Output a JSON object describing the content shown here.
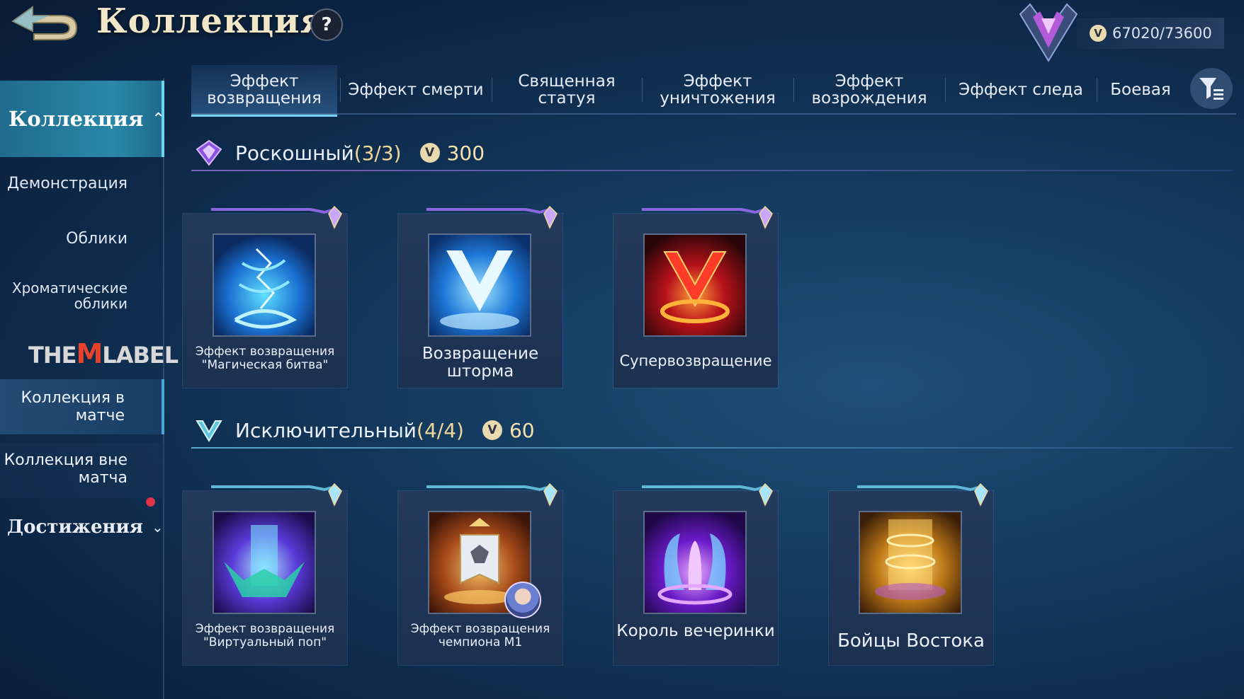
{
  "header": {
    "title": "Коллекция",
    "help_label": "?",
    "points": "67020/73600",
    "coin_glyph": "V"
  },
  "sidebar": {
    "active": "Коллекция",
    "items": [
      {
        "label": "Демонстрация"
      },
      {
        "label": "Облики"
      },
      {
        "label": "Хроматические облики"
      },
      {
        "label": "Коллекция в матче"
      },
      {
        "label": "Коллекция вне матча"
      }
    ],
    "brand_logo": {
      "pre": "THE",
      "m": "M",
      "post": "LABEL"
    },
    "achievements": "Достижения"
  },
  "tabs": [
    {
      "label": "Эффект возвращения",
      "active": true
    },
    {
      "label": "Эффект смерти"
    },
    {
      "label": "Священная статуя"
    },
    {
      "label": "Эффект уничтожения"
    },
    {
      "label": "Эффект возрождения"
    },
    {
      "label": "Эффект следа"
    },
    {
      "label": "Боевая"
    }
  ],
  "sections": [
    {
      "title": "Роскошный",
      "count": "(3/3)",
      "price": "300",
      "accent": "#9b6cf0",
      "items": [
        {
          "name": "Эффект возвращения \"Магическая битва\"",
          "icon": "blue-lightning-swirl-icon"
        },
        {
          "name": "Возвращение шторма",
          "icon": "blue-v-storm-icon"
        },
        {
          "name": "Супервозвращение",
          "icon": "red-v-fire-ring-icon"
        }
      ]
    },
    {
      "title": "Исключительный",
      "count": "(4/4)",
      "price": "60",
      "accent": "#6fd0e8",
      "items": [
        {
          "name": "Эффект возвращения \"Виртуальный поп\"",
          "icon": "purple-crown-portal-icon"
        },
        {
          "name": "Эффект возвращения чемпиона М1",
          "icon": "champion-banner-icon"
        },
        {
          "name": "Король вечеринки",
          "icon": "purple-fountain-icon"
        },
        {
          "name": "Бойцы Востока",
          "icon": "golden-pillar-icon"
        }
      ]
    }
  ]
}
